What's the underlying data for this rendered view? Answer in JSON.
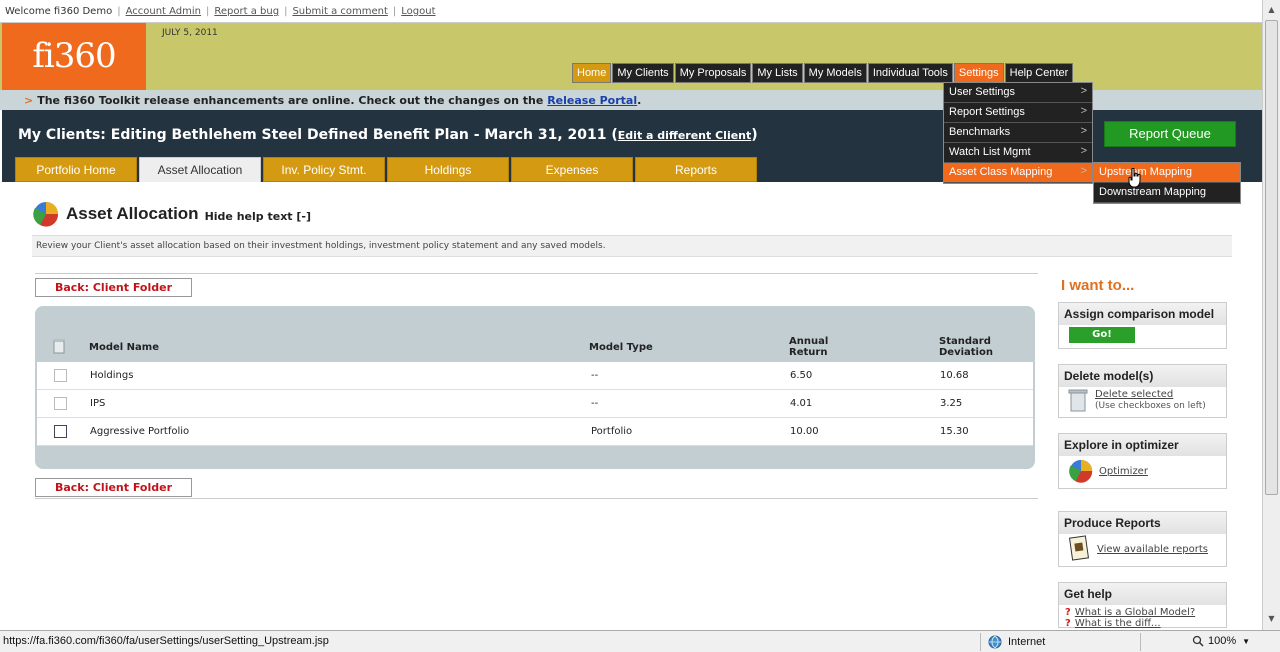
{
  "userbar": {
    "welcome": "Welcome fi360 Demo",
    "links": [
      "Account Admin",
      "Report a bug",
      "Submit a comment",
      "Logout"
    ]
  },
  "header": {
    "logo": "fi360",
    "date": "JULY 5, 2011",
    "nav": [
      "Home",
      "My Clients",
      "My Proposals",
      "My Lists",
      "My Models",
      "Individual Tools",
      "Settings",
      "Help Center"
    ]
  },
  "announce": {
    "text": "The fi360 Toolkit release enhancements are online. Check out the changes on the",
    "link": "Release Portal",
    "tail": "."
  },
  "page": {
    "title": "My Clients: Editing Bethlehem Steel Defined Benefit Plan - March 31, 2011",
    "edit_link": "Edit a different Client",
    "queue_button": "Report Queue",
    "tabs": [
      "Portfolio Home",
      "Asset Allocation",
      "Inv. Policy Stmt.",
      "Holdings",
      "Expenses",
      "Reports"
    ]
  },
  "settings_menu": {
    "items": [
      "User Settings",
      "Report Settings",
      "Benchmarks",
      "Watch List Mgmt",
      "Asset Class Mapping"
    ],
    "submenu": [
      "Upstream Mapping",
      "Downstream Mapping"
    ]
  },
  "section": {
    "title": "Asset Allocation",
    "hide_help": "Hide help text [-]",
    "help_text": "Review your Client's asset allocation based on their investment holdings, investment policy statement and any saved models.",
    "back_label": "Back: Client Folder"
  },
  "table": {
    "headers": {
      "name": "Model Name",
      "type": "Model Type",
      "ret1": "Annual",
      "ret2": "Return",
      "sd1": "Standard",
      "sd2": "Deviation"
    },
    "rows": [
      {
        "name": "Holdings",
        "type": "--",
        "ret": "6.50",
        "sd": "10.68"
      },
      {
        "name": "IPS",
        "type": "--",
        "ret": "4.01",
        "sd": "3.25"
      },
      {
        "name": "Aggressive Portfolio",
        "type": "Portfolio",
        "ret": "10.00",
        "sd": "15.30"
      }
    ]
  },
  "sidebar": {
    "heading": "I want to...",
    "assign": {
      "title": "Assign comparison model",
      "button": "Go!"
    },
    "delete": {
      "title": "Delete model(s)",
      "link": "Delete selected",
      "note": "(Use checkboxes on left)"
    },
    "explore": {
      "title": "Explore in optimizer",
      "link": "Optimizer"
    },
    "produce": {
      "title": "Produce Reports",
      "link": "View available reports"
    },
    "help": {
      "title": "Get help",
      "link1": "What is a Global Model?",
      "link2": "What is the diff..."
    }
  },
  "status": {
    "url": "https://fa.fi360.com/fi360/fa/userSettings/userSetting_Upstream.jsp",
    "zone": "Internet",
    "zoom": "100%"
  },
  "colors": {
    "orange": "#f06a1e",
    "gold": "#d49a12",
    "olive": "#c8c86b",
    "dark": "#233340",
    "green": "#229922"
  }
}
